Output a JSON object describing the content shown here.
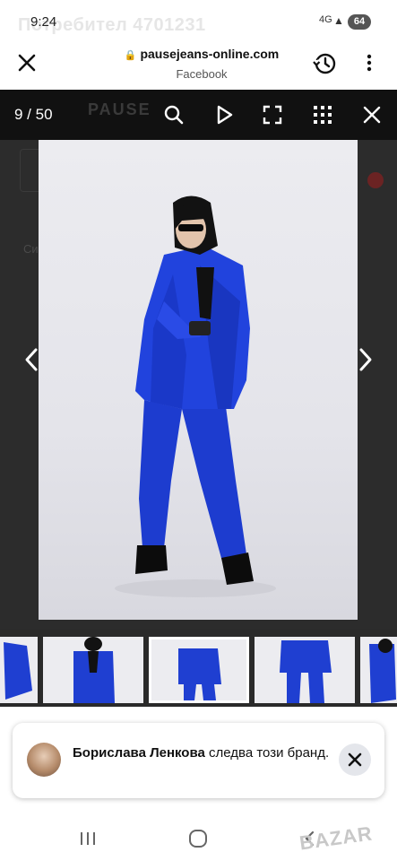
{
  "status_bar": {
    "time": "9:24",
    "ghost_title": "Потребител 4701231",
    "signal": "4G",
    "battery": "64"
  },
  "browser": {
    "url": "pausejeans-online.com",
    "referrer": "Facebook",
    "icons": [
      "close-icon",
      "lock-icon",
      "history-icon",
      "more-vert-icon"
    ]
  },
  "gallery": {
    "counter": "9 / 50",
    "ghost_logo": "PAUSE",
    "toolbar_icons": [
      "zoom-icon",
      "play-icon",
      "fullscreen-icon",
      "grid-icon",
      "close-icon"
    ],
    "ghost_label": "Си",
    "thumbnails": [
      {
        "id": "thumb-8",
        "active": false
      },
      {
        "id": "thumb-9",
        "active": false
      },
      {
        "id": "thumb-10",
        "active": true
      },
      {
        "id": "thumb-11",
        "active": false
      },
      {
        "id": "thumb-12",
        "active": false
      }
    ],
    "colors": {
      "suit": "#1f3fd1",
      "background": "#ececf0",
      "overlay": "#111111"
    }
  },
  "toast": {
    "name": "Борислава Ленкова",
    "text": " следва този бранд."
  },
  "navbar": {
    "icons": [
      "recents-icon",
      "home-icon",
      "back-icon"
    ],
    "watermark": "BAZAR"
  }
}
